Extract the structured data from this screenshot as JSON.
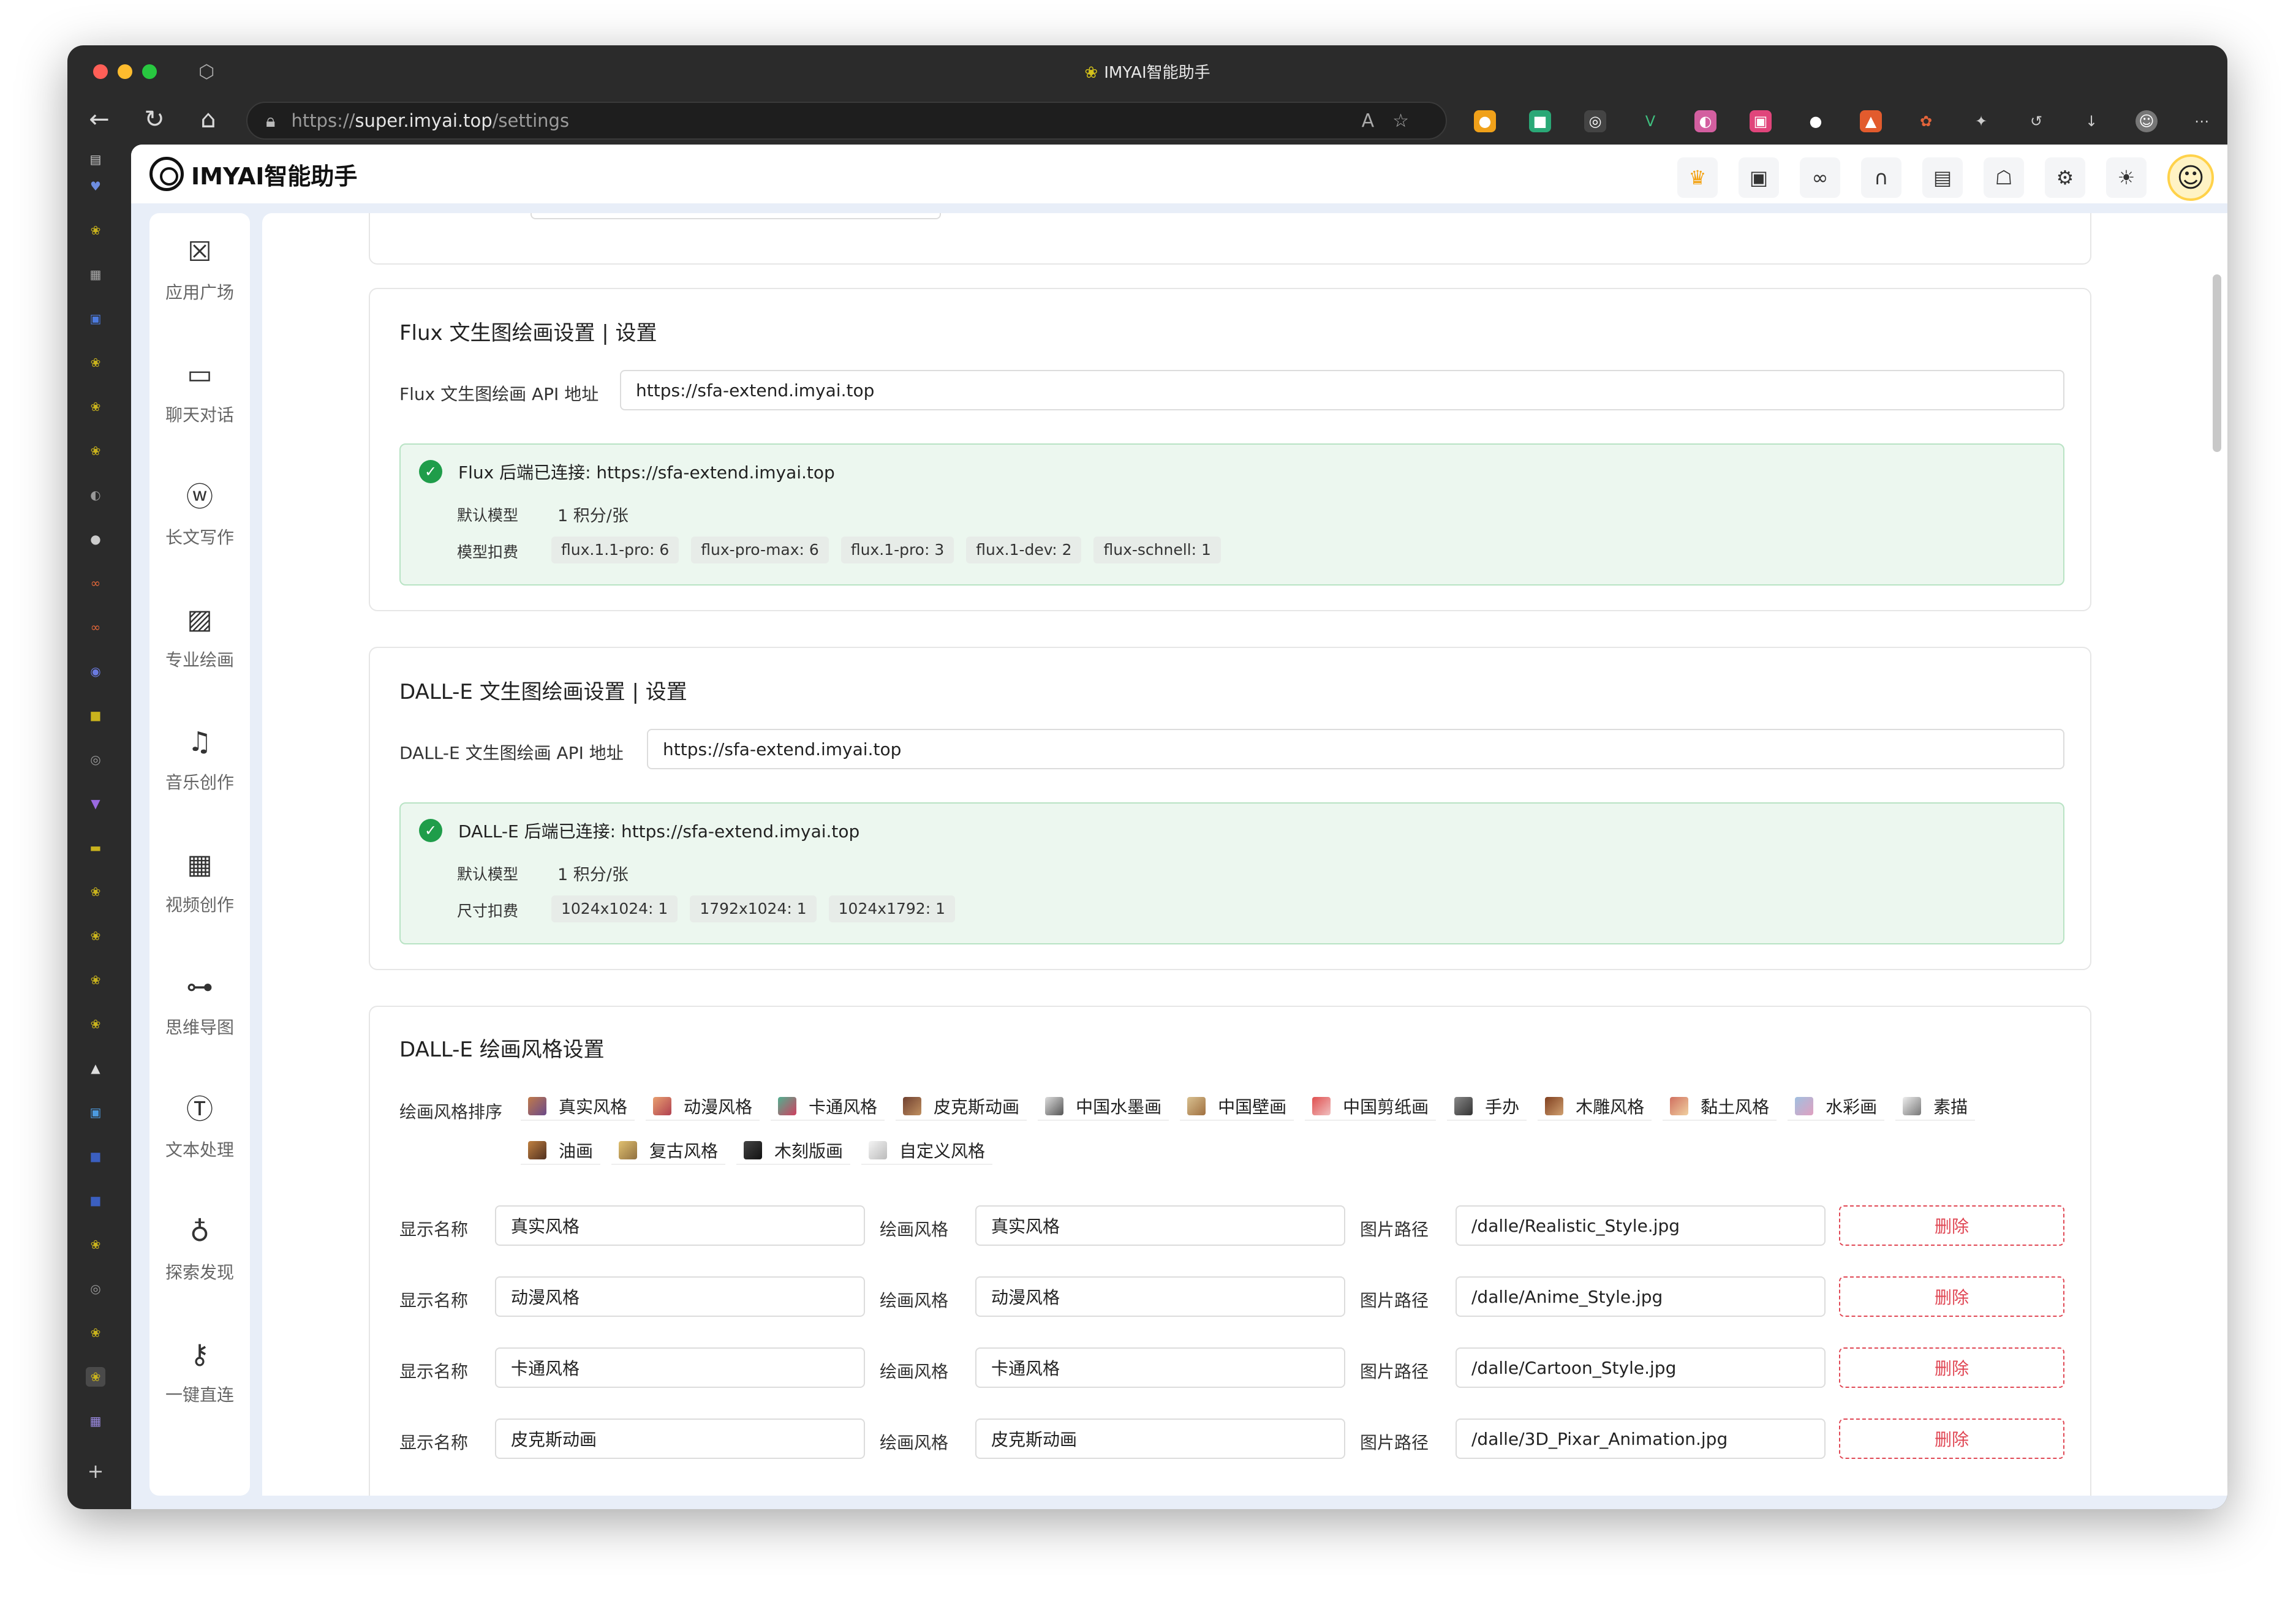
{
  "browser": {
    "window_title": "IMYAI智能助手",
    "url_scheme": "https://",
    "url_host": "super.imyai.top",
    "url_path": "/settings"
  },
  "app": {
    "brand": "IMYAI智能助手"
  },
  "nav": [
    {
      "label": "应用广场",
      "icon": "app-grid-icon"
    },
    {
      "label": "聊天对话",
      "icon": "chat-icon"
    },
    {
      "label": "长文写作",
      "icon": "word-doc-icon"
    },
    {
      "label": "专业绘画",
      "icon": "image-icon"
    },
    {
      "label": "音乐创作",
      "icon": "music-icon"
    },
    {
      "label": "视频创作",
      "icon": "film-icon"
    },
    {
      "label": "思维导图",
      "icon": "mindmap-icon"
    },
    {
      "label": "文本处理",
      "icon": "text-icon"
    },
    {
      "label": "探索发现",
      "icon": "planet-icon"
    },
    {
      "label": "一键直连",
      "icon": "key-icon"
    }
  ],
  "flux": {
    "title": "Flux 文生图绘画设置 | 设置",
    "api_label": "Flux 文生图绘画 API 地址",
    "api_value": "https://sfa-extend.imyai.top",
    "status": "Flux 后端已连接: https://sfa-extend.imyai.top",
    "default_model_label": "默认模型",
    "default_model_value": "1 积分/张",
    "cost_label": "模型扣费",
    "costs": [
      "flux.1.1-pro: 6",
      "flux-pro-max: 6",
      "flux.1-pro: 3",
      "flux.1-dev: 2",
      "flux-schnell: 1"
    ]
  },
  "dalle": {
    "title": "DALL-E 文生图绘画设置 | 设置",
    "api_label": "DALL-E 文生图绘画 API 地址",
    "api_value": "https://sfa-extend.imyai.top",
    "status": "DALL-E 后端已连接: https://sfa-extend.imyai.top",
    "default_model_label": "默认模型",
    "default_model_value": "1 积分/张",
    "cost_label": "尺寸扣费",
    "costs": [
      "1024x1024: 1",
      "1792x1024: 1",
      "1024x1792: 1"
    ]
  },
  "styles": {
    "title": "DALL-E 绘画风格设置",
    "order_label": "绘画风格排序",
    "order": [
      "真实风格",
      "动漫风格",
      "卡通风格",
      "皮克斯动画",
      "中国水墨画",
      "中国壁画",
      "中国剪纸画",
      "手办",
      "木雕风格",
      "黏土风格",
      "水彩画",
      "素描",
      "油画",
      "复古风格",
      "木刻版画",
      "自定义风格"
    ],
    "name_label": "显示名称",
    "style_label": "绘画风格",
    "path_label": "图片路径",
    "delete_label": "删除",
    "rows": [
      {
        "name": "真实风格",
        "style": "真实风格",
        "path": "/dalle/Realistic_Style.jpg"
      },
      {
        "name": "动漫风格",
        "style": "动漫风格",
        "path": "/dalle/Anime_Style.jpg"
      },
      {
        "name": "卡通风格",
        "style": "卡通风格",
        "path": "/dalle/Cartoon_Style.jpg"
      },
      {
        "name": "皮克斯动画",
        "style": "皮克斯动画",
        "path": "/dalle/3D_Pixar_Animation.jpg"
      }
    ]
  },
  "colors": {
    "success": "#1f9d4a",
    "danger": "#e04855",
    "accent": "#f3a212"
  }
}
